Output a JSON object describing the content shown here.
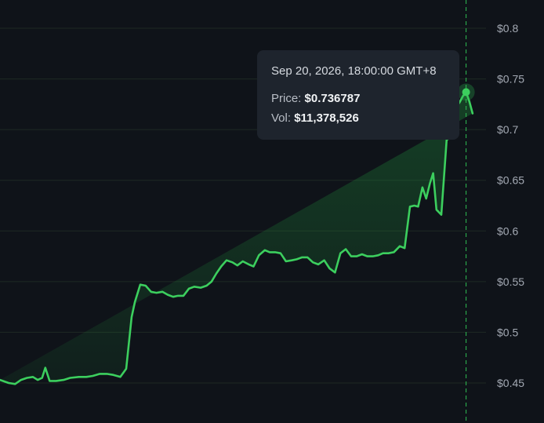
{
  "chart_data": {
    "type": "area",
    "title": "",
    "xlabel": "",
    "ylabel": "",
    "ylim": [
      0.415,
      0.81
    ],
    "y_ticks": [
      0.8,
      0.75,
      0.7,
      0.65,
      0.6,
      0.55,
      0.5,
      0.45
    ],
    "y_tick_labels": [
      "$0.8",
      "$0.75",
      "$0.7",
      "$0.65",
      "$0.6",
      "$0.55",
      "$0.5",
      "$0.45"
    ],
    "y_axis_position": "right",
    "grid": true,
    "line_color": "#3ccf5e",
    "fill_color": "#1f8a3a",
    "x_range": [
      0,
      100
    ],
    "x": [
      0,
      1.6,
      2.8,
      3.9,
      5.0,
      6.1,
      7.0,
      7.8,
      8.4,
      9.2,
      10.4,
      11.8,
      13.0,
      14.6,
      16.0,
      17.2,
      18.5,
      19.8,
      21.0,
      22.3,
      23.4,
      24.4,
      25.0,
      26.0,
      27.0,
      28.0,
      29.0,
      30.1,
      31.1,
      32.1,
      33.0,
      34.0,
      35.0,
      36.0,
      37.2,
      38.3,
      39.2,
      40.1,
      41.0,
      42.0,
      43.1,
      44.0,
      45.0,
      46.1,
      47.0,
      48.0,
      49.1,
      50.0,
      51.0,
      52.0,
      53.0,
      54.1,
      55.0,
      56.0,
      57.0,
      58.0,
      59.0,
      60.1,
      61.1,
      62.1,
      63.1,
      64.1,
      65.1,
      66.1,
      67.1,
      68.1,
      69.1,
      70.1,
      71.0,
      72.0,
      73.0,
      74.1,
      75.0,
      76.0,
      76.8,
      77.5,
      78.3,
      79.0,
      79.7,
      80.3,
      80.9,
      81.8,
      82.8,
      83.8,
      84.5,
      85.2,
      85.8,
      86.4,
      87.0,
      87.6,
      88.2
    ],
    "values": [
      0.453,
      0.45,
      0.449,
      0.453,
      0.455,
      0.456,
      0.453,
      0.455,
      0.465,
      0.452,
      0.452,
      0.453,
      0.455,
      0.456,
      0.456,
      0.457,
      0.459,
      0.459,
      0.458,
      0.456,
      0.464,
      0.515,
      0.53,
      0.547,
      0.546,
      0.54,
      0.539,
      0.54,
      0.537,
      0.535,
      0.536,
      0.536,
      0.543,
      0.545,
      0.544,
      0.546,
      0.55,
      0.558,
      0.565,
      0.571,
      0.569,
      0.566,
      0.57,
      0.567,
      0.565,
      0.576,
      0.581,
      0.579,
      0.579,
      0.578,
      0.57,
      0.571,
      0.572,
      0.574,
      0.574,
      0.569,
      0.567,
      0.571,
      0.563,
      0.559,
      0.578,
      0.582,
      0.575,
      0.575,
      0.577,
      0.575,
      0.575,
      0.576,
      0.578,
      0.578,
      0.579,
      0.585,
      0.583,
      0.624,
      0.625,
      0.624,
      0.643,
      0.632,
      0.647,
      0.657,
      0.621,
      0.616,
      0.69,
      0.693,
      0.722,
      0.727,
      0.733,
      0.737,
      0.728,
      0.716
    ],
    "highlight": {
      "index": 87,
      "date": "Sep 20, 2026, 18:00:00 GMT+8",
      "price_label": "Price:",
      "price": "$0.736787",
      "vol_label": "Vol:",
      "vol": "$11,378,526"
    }
  }
}
